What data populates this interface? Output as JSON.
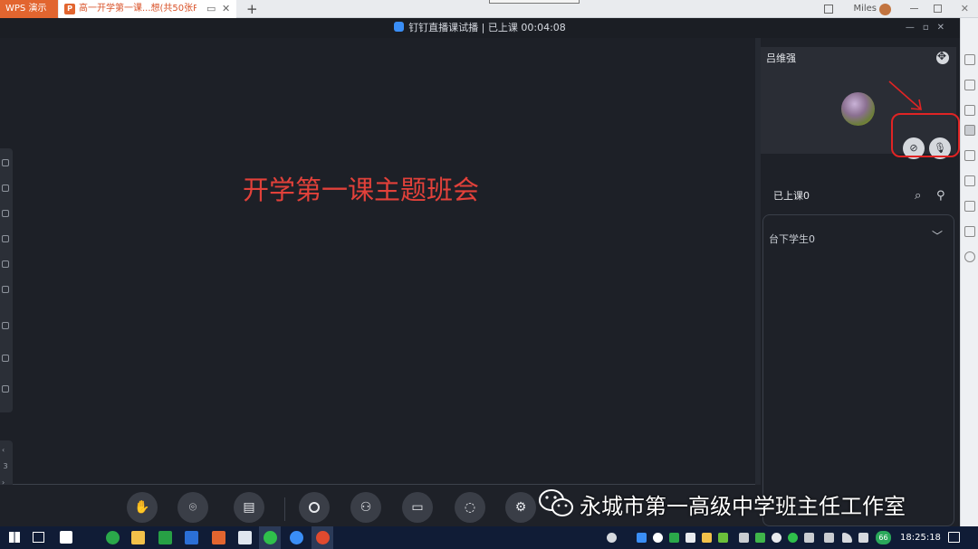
{
  "browser": {
    "wps_tab_label": "WPS 演示",
    "doc_tab_label": "高一开学第一课...想(共50张P",
    "new_tab_glyph": "+",
    "user_name": "Miles"
  },
  "live": {
    "title": "钉钉直播课试播 | 已上课 00:04:08",
    "slide_title": "开学第一课主题班会",
    "page_indicator": "3"
  },
  "panel": {
    "teacher_name": "吕维强",
    "class_label": "已上课0",
    "students_label": "台下学生0"
  },
  "watermark": "永城市第一高级中学班主任工作室",
  "taskbar": {
    "clock": "18:25:18",
    "badge": "66"
  },
  "colors": {
    "slide_title": "#e2413a",
    "highlight": "#e02424",
    "wps_orange": "#e2652f",
    "live_bg": "#1e2128"
  }
}
